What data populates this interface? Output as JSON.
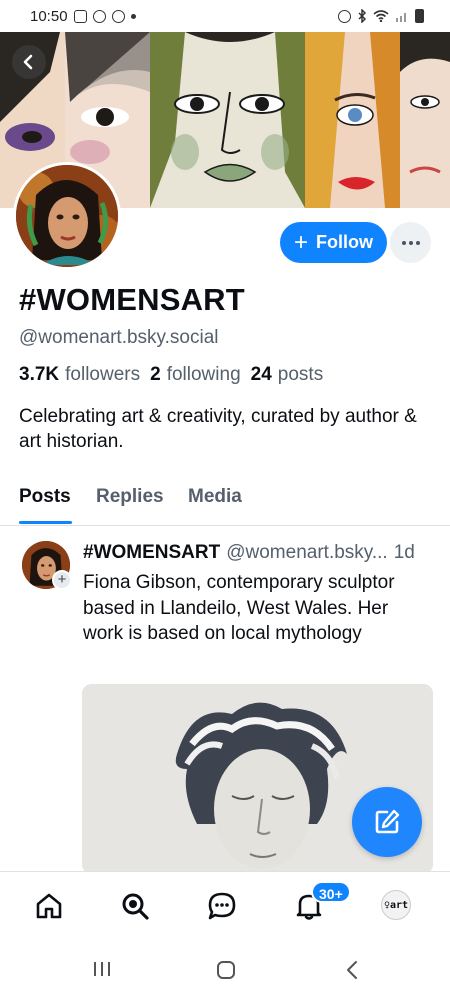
{
  "status_bar": {
    "time": "10:50"
  },
  "profile": {
    "display_name": "#WOMENSART",
    "handle": "@womenart.bsky.social",
    "followers_count": "3.7K",
    "followers_label": "followers",
    "following_count": "2",
    "following_label": "following",
    "posts_count": "24",
    "posts_label": "posts",
    "bio": "Celebrating art & creativity, curated by author & art historian."
  },
  "actions": {
    "follow_label": "Follow",
    "follow_icon": "+"
  },
  "tabs": [
    {
      "label": "Posts",
      "active": true
    },
    {
      "label": "Replies",
      "active": false
    },
    {
      "label": "Media",
      "active": false
    }
  ],
  "post": {
    "author_name": "#WOMENSART",
    "author_handle": "@womenart.bsky...",
    "time": "1d",
    "text": "Fiona Gibson, contemporary sculptor based in Llandeilo, West Wales. Her work is based on local mythology",
    "avatar_follow_icon": "+"
  },
  "bottom_nav": {
    "notifications_badge": "30+",
    "profile_avatar_text": "♀art",
    "items": [
      "home-icon",
      "search-icon",
      "chat-icon",
      "bell-icon",
      "profile-avatar"
    ]
  },
  "colors": {
    "accent": "#1083fe",
    "muted_text": "#55606c",
    "text": "#0b0f14"
  }
}
